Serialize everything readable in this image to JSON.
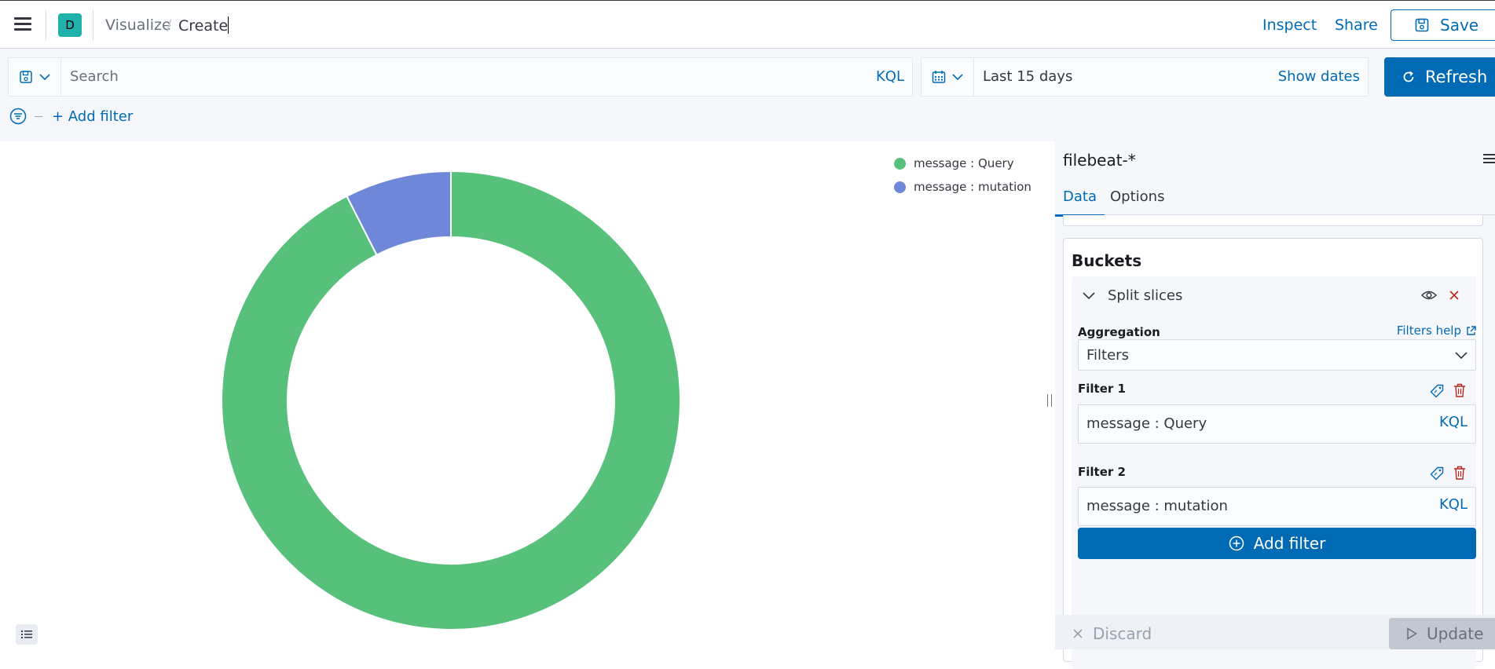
{
  "header": {
    "space_initial": "D",
    "breadcrumbs": [
      {
        "label": "Visualize"
      },
      {
        "label": "Create"
      }
    ],
    "separator": "/",
    "inspect_label": "Inspect",
    "share_label": "Share",
    "save_label": "Save"
  },
  "query": {
    "search_placeholder": "Search",
    "language": "KQL",
    "date_range": "Last 15 days",
    "show_dates_label": "Show dates",
    "refresh_label": "Refresh",
    "add_filter_label": "+ Add filter"
  },
  "chart_data": {
    "type": "pie",
    "donut": true,
    "categories": [
      "message : Query",
      "message : mutation"
    ],
    "values": [
      92.5,
      7.5
    ],
    "colors": [
      "#57c17b",
      "#6f87d8"
    ],
    "legend_position": "top-right"
  },
  "sidebar": {
    "index_pattern": "filebeat-*",
    "tabs": [
      {
        "label": "Data",
        "active": true
      },
      {
        "label": "Options",
        "active": false
      }
    ],
    "buckets_title": "Buckets",
    "split_title": "Split slices",
    "aggregation_label": "Aggregation",
    "filters_help_label": "Filters help",
    "aggregation_value": "Filters",
    "filters": [
      {
        "label": "Filter 1",
        "value": "message : Query",
        "language": "KQL"
      },
      {
        "label": "Filter 2",
        "value": "message : mutation",
        "language": "KQL"
      }
    ],
    "add_filter_label": "Add filter",
    "discard_label": "Discard",
    "update_label": "Update"
  },
  "icons": {
    "menu": "hamburger-icon",
    "save": "save-disk-icon",
    "saved_query": "saved-query-icon",
    "calendar": "calendar-icon",
    "refresh": "refresh-icon",
    "filter": "filter-icon",
    "legend_toggle": "legend-list-icon",
    "eye": "eye-icon",
    "close": "close-icon",
    "tag": "tag-icon",
    "trash": "trash-icon",
    "external_link": "external-link-icon",
    "add": "plus-circle-icon",
    "play": "play-icon"
  }
}
